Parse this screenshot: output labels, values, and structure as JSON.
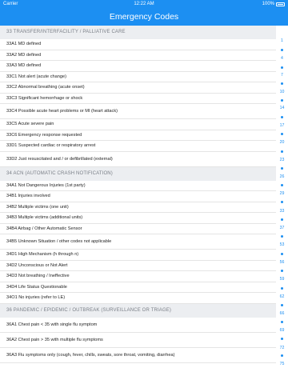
{
  "status_bar": {
    "carrier": "Carrier",
    "time": "12:22 AM",
    "battery": "100%"
  },
  "nav": {
    "title": "Emergency Codes"
  },
  "sections": [
    {
      "header": "33 TRANSFER/INTERFACILITY / PALLIATIVE CARE",
      "rows": [
        "33A1 MD defined",
        "33A2 MD defined",
        "33A3 MD defined",
        "33C1 Not alert (acute change)",
        "33C2 Abnormal breathing (acute onset)",
        "33C3 Significant hemorrhage or shock",
        "33C4 Possible acute heart problems or MI (heart attack)",
        "33C5 Acute severe pain",
        "33C6 Emergency response requested",
        "33D1 Suspected cardiac or respiratory arrest",
        "33D2 Just resuscitated and / or defibrillated (external)"
      ]
    },
    {
      "header": "34 ACN (AUTOMATIC CRASH NOTIFICATION)",
      "rows": [
        "34A1 Not Dangerous Injuries (1st party)",
        "34B1 Injuries involved",
        "34B2 Multiple victims (one unit)",
        "34B3 Multiple victims (additional units)",
        "34B4 Airbag  /  Other Automatic Sensor",
        "34B5 Unknown Situation  /  other codes not applicable",
        "34D1 High Mechanism (h through n)",
        "34D2 Unconscious or Not Alert",
        "34D3 Not breathing  /  Ineffective",
        "34D4 Life Status Questionable",
        "34O1 No injuries (refer to LE)"
      ]
    },
    {
      "header": "36 PANDEMIC / EPIDEMIC / OUTBREAK (SURVEILLANCE OR TRIAGE)",
      "rows": [
        "36A1 Chest pain < 35 with single flu    symptom",
        "36A2 Chest pain > 35 with multiple flu symptoms",
        "36A3 Flu symptoms only (cough, fever,    chills, sweats, sore throat, vomiting,    diarrhea)"
      ]
    }
  ],
  "index": [
    "1",
    "4",
    "7",
    "10",
    "14",
    "17",
    "20",
    "23",
    "26",
    "29",
    "33",
    "37",
    "53",
    "56",
    "59",
    "62",
    "66",
    "69",
    "72",
    "75"
  ]
}
